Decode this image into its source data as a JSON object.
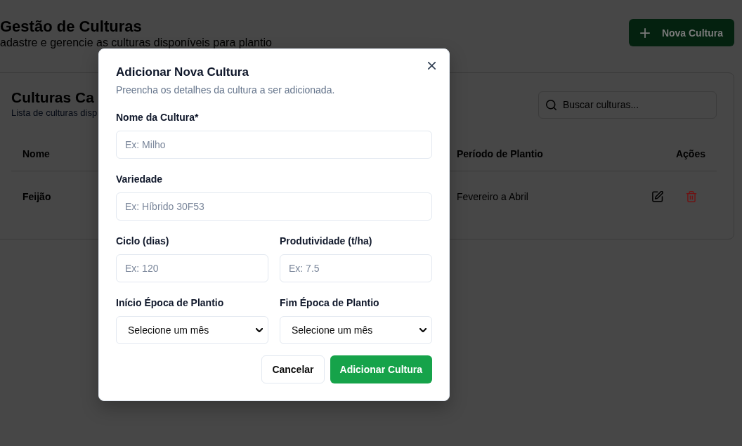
{
  "header": {
    "title": "Gestão de Culturas",
    "subtitle": "adastre e gerencie as culturas disponíveis para plantio",
    "button": {
      "label": "Nova Cultura"
    }
  },
  "card": {
    "title": "Culturas Ca",
    "subtitle": "Lista de culturas disp",
    "search": {
      "placeholder": "Buscar culturas..."
    },
    "table": {
      "columns": [
        "Nome",
        "Período de Plantio",
        "Ações"
      ],
      "rows": [
        [
          "Feijão",
          "Fevereiro a Abril"
        ]
      ]
    }
  },
  "dialog": {
    "title": "Adicionar Nova Cultura",
    "description": "Preencha os detalhes da cultura a ser adicionada.",
    "rows": [
      [
        {
          "kind": "input",
          "label": "Nome da Cultura*",
          "placeholder": "Ex: Milho"
        }
      ],
      [
        {
          "kind": "input",
          "label": "Variedade",
          "placeholder": "Ex: Híbrido 30F53"
        }
      ],
      [
        {
          "kind": "input",
          "label": "Ciclo (dias)",
          "placeholder": "Ex: 120"
        },
        {
          "kind": "input",
          "label": "Produtividade (t/ha)",
          "placeholder": "Ex: 7.5"
        }
      ],
      [
        {
          "kind": "select",
          "label": "Início Época de Plantio",
          "value": "Selecione um mês"
        },
        {
          "kind": "select",
          "label": "Fim Época de Plantio",
          "value": "Selecione um mês"
        }
      ]
    ],
    "buttons": [
      {
        "kind": "secondary",
        "label": "Cancelar"
      },
      {
        "kind": "primary",
        "label": "Adicionar Cultura"
      }
    ]
  }
}
